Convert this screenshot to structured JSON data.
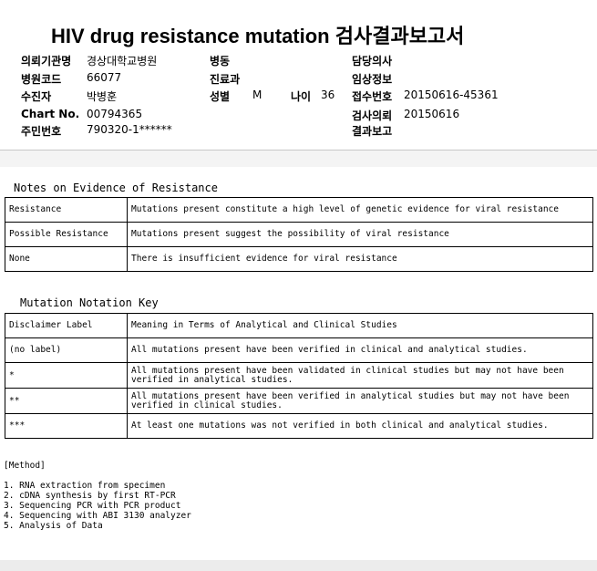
{
  "report": {
    "title": "HIV drug resistance mutation 검사결과보고서",
    "fields": {
      "institution_label": "의뢰기관명",
      "institution_value": "경상대학교병원",
      "hospital_code_label": "병원코드",
      "hospital_code_value": "66077",
      "patient_label": "수진자",
      "patient_value": "박병훈",
      "chart_label": "Chart No.",
      "chart_value": "00794365",
      "rrn_label": "주민번호",
      "rrn_value": "790320-1******",
      "ward_label": "병동",
      "department_label": "진료과",
      "sex_label": "성별",
      "sex_value": "M",
      "age_label": "나이",
      "age_value": "36",
      "doctor_label": "담당의사",
      "clinical_label": "임상정보",
      "accession_label": "접수번호",
      "accession_value": "20150616-45361",
      "request_label": "검사의뢰",
      "request_value": "20150616",
      "result_label": "결과보고"
    }
  },
  "evidence": {
    "title": "Notes on Evidence of Resistance",
    "rows": [
      {
        "label": "Resistance",
        "text": "Mutations present  constitute a high level of genetic evidence for viral resistance"
      },
      {
        "label": "Possible Resistance",
        "text": "Mutations present suggest the possibility of viral resistance"
      },
      {
        "label": "None",
        "text": "There is insufficient evidence for viral resistance"
      }
    ]
  },
  "notation": {
    "title": "Mutation Notation Key",
    "header": {
      "label": "Disclaimer Label",
      "text": "Meaning in Terms of Analytical and Clinical Studies"
    },
    "rows": [
      {
        "label": "(no label)",
        "text": "All mutations present have been verified in clinical and analytical studies."
      },
      {
        "label": "*",
        "text": "All mutations present have been  validated in clinical studies but may not have been verified in analytical studies."
      },
      {
        "label": "**",
        "text": "All mutations present have been verified in analytical studies but may not have been verified in clinical studies."
      },
      {
        "label": "***",
        "text": "At least one mutations was not verified in both clinical and analytical studies."
      }
    ]
  },
  "method": {
    "title": "[Method]",
    "steps": [
      "1. RNA extraction from specimen",
      "2. cDNA synthesis by first RT-PCR",
      "3. Sequencing PCR with PCR product",
      "4. Sequencing with ABI 3130 analyzer",
      "5. Analysis of Data"
    ]
  }
}
